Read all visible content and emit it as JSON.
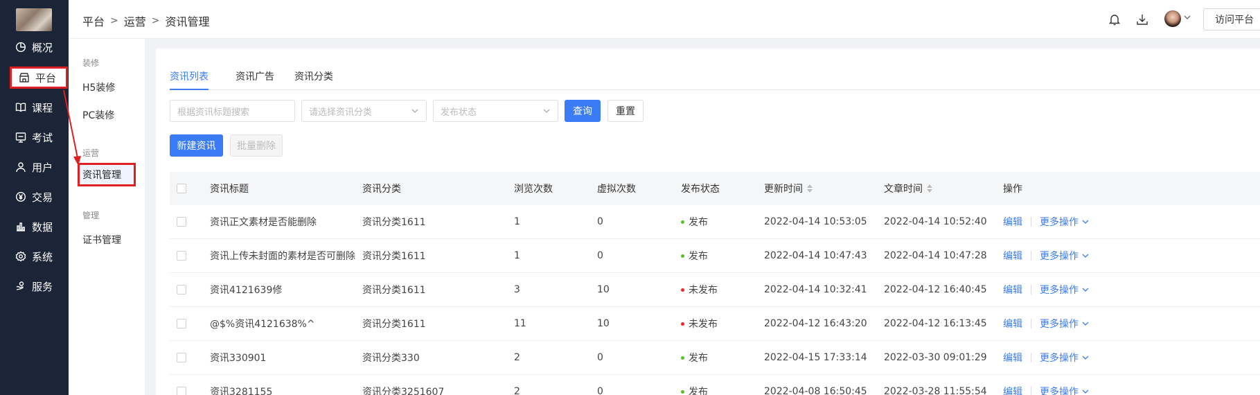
{
  "breadcrumb": [
    "平台",
    "运营",
    "资讯管理"
  ],
  "header": {
    "visit_label": "访问平台"
  },
  "leftnav": [
    {
      "label": "概况",
      "icon": "pie-chart-icon"
    },
    {
      "label": "平台",
      "icon": "store-icon",
      "active": true
    },
    {
      "label": "课程",
      "icon": "book-icon"
    },
    {
      "label": "考试",
      "icon": "exam-icon"
    },
    {
      "label": "用户",
      "icon": "user-icon"
    },
    {
      "label": "交易",
      "icon": "yen-icon"
    },
    {
      "label": "数据",
      "icon": "bar-chart-icon"
    },
    {
      "label": "系统",
      "icon": "gear-icon"
    },
    {
      "label": "服务",
      "icon": "service-icon"
    }
  ],
  "submenu": {
    "group1": "装修",
    "item_h5": "H5装修",
    "item_pc": "PC装修",
    "group2": "运营",
    "item_news": "资讯管理",
    "group3": "管理",
    "item_cert": "证书管理"
  },
  "tabs": [
    "资讯列表",
    "资讯广告",
    "资讯分类"
  ],
  "filters": {
    "search_placeholder": "根据资讯标题搜索",
    "category_placeholder": "请选择资讯分类",
    "status_placeholder": "发布状态",
    "query_label": "查询",
    "reset_label": "重置"
  },
  "actions": {
    "new_label": "新建资讯",
    "batch_delete_label": "批量删除"
  },
  "table": {
    "headers": [
      "资讯标题",
      "资讯分类",
      "浏览次数",
      "虚拟次数",
      "发布状态",
      "更新时间",
      "文章时间",
      "操作"
    ],
    "rows": [
      {
        "title": "资讯正文素材是否能删除",
        "category": "资讯分类1611",
        "views": "1",
        "virtual": "0",
        "status": "发布",
        "updated": "2022-04-14 10:53:05",
        "article_time": "2022-04-14 10:52:40"
      },
      {
        "title": "资讯上传未封面的素材是否可删除",
        "category": "资讯分类1611",
        "views": "1",
        "virtual": "0",
        "status": "发布",
        "updated": "2022-04-14 10:47:43",
        "article_time": "2022-04-14 10:47:28"
      },
      {
        "title": "资讯4121639修",
        "category": "资讯分类1611",
        "views": "3",
        "virtual": "10",
        "status": "未发布",
        "updated": "2022-04-14 10:32:41",
        "article_time": "2022-04-12 16:40:45"
      },
      {
        "title": "@$%资讯4121638%^",
        "category": "资讯分类1611",
        "views": "11",
        "virtual": "10",
        "status": "未发布",
        "updated": "2022-04-12 16:43:20",
        "article_time": "2022-04-12 16:13:45"
      },
      {
        "title": "资讯330901",
        "category": "资讯分类330",
        "views": "2",
        "virtual": "0",
        "status": "发布",
        "updated": "2022-04-15 17:33:14",
        "article_time": "2022-03-30 09:01:29"
      },
      {
        "title": "资讯3281155",
        "category": "资讯分类3251607",
        "views": "2",
        "virtual": "0",
        "status": "发布",
        "updated": "2022-04-08 16:50:45",
        "article_time": "2022-03-28 11:55:54"
      }
    ],
    "edit_label": "编辑",
    "more_label": "更多操作"
  },
  "colors": {
    "accent": "#3a7bf6",
    "nav_bg": "#1c2437",
    "published": "#52c41a",
    "unpublished": "#f5222d",
    "annotation": "#e02020"
  }
}
